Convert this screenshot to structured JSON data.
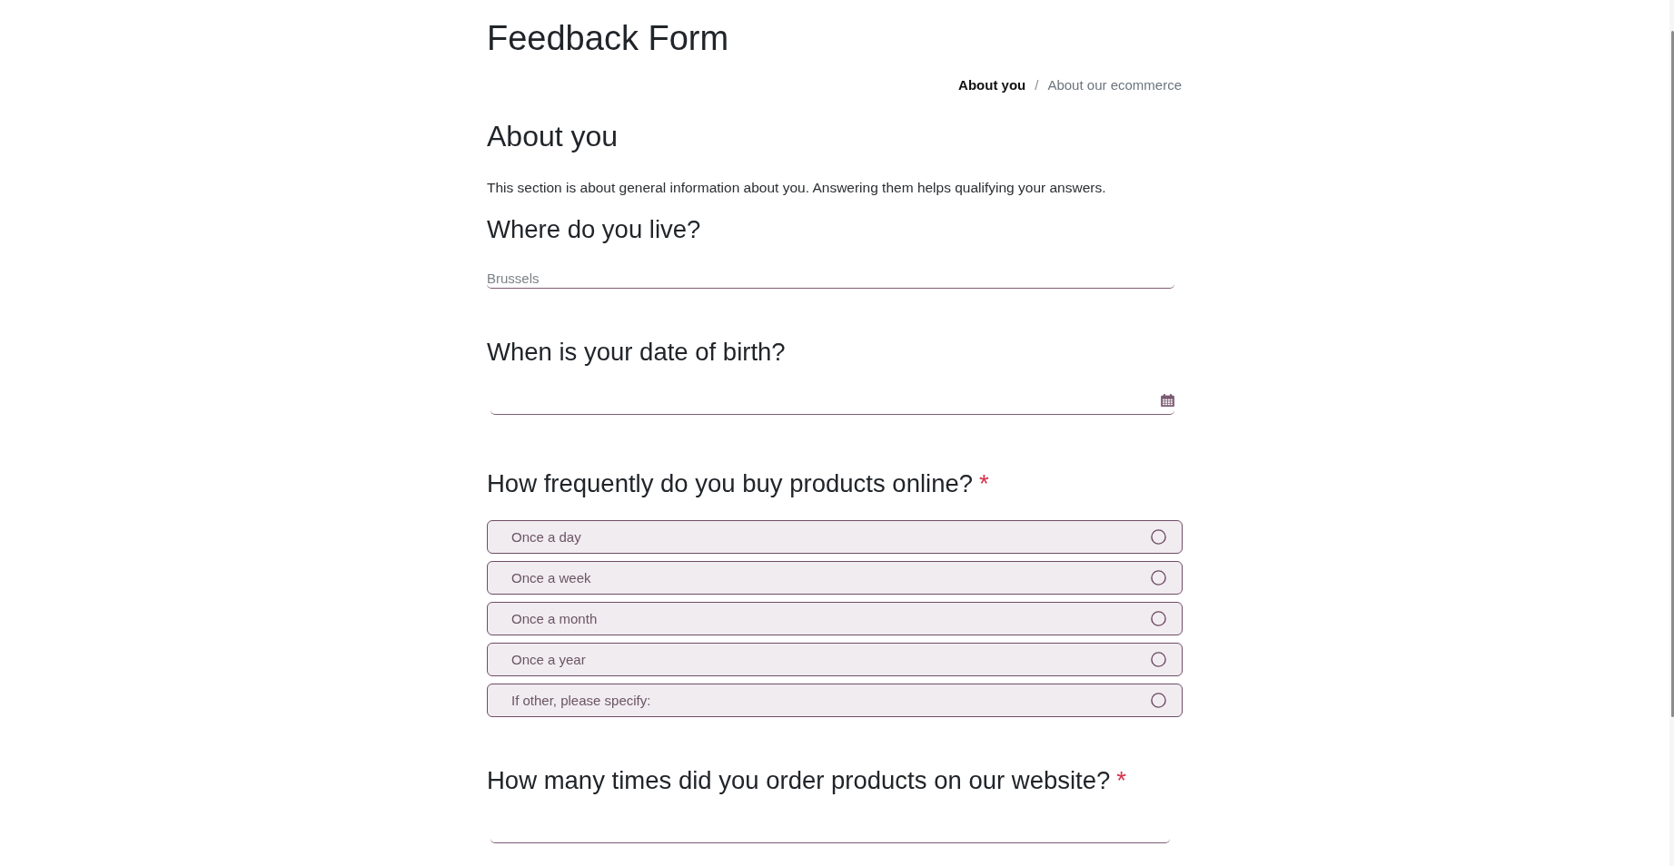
{
  "page": {
    "title": "Feedback Form"
  },
  "breadcrumb": [
    {
      "label": "About you",
      "selected": true
    },
    {
      "label": "About our ecommerce",
      "selected": false
    }
  ],
  "breadcrumb_separator": "/",
  "section": {
    "title": "About you",
    "description": "This section is about general information about you. Answering them helps qualifying your answers."
  },
  "questions": [
    {
      "kind": "text",
      "title": "Where do you live?",
      "placeholder": "Brussels"
    },
    {
      "kind": "date",
      "title": "When is your date of birth?"
    },
    {
      "kind": "choice",
      "title": "How frequently do you buy products online?",
      "required_mark": "*",
      "options": [
        {
          "label": "Once a day",
          "selected": false
        },
        {
          "label": "Once a week",
          "selected": false
        },
        {
          "label": "Once a month",
          "selected": false
        },
        {
          "label": "Once a year",
          "selected": false
        },
        {
          "label": "If other, please specify:",
          "selected": false
        }
      ]
    },
    {
      "kind": "number",
      "title": "How many times did you order products on our website?",
      "required_mark": "*"
    }
  ]
}
